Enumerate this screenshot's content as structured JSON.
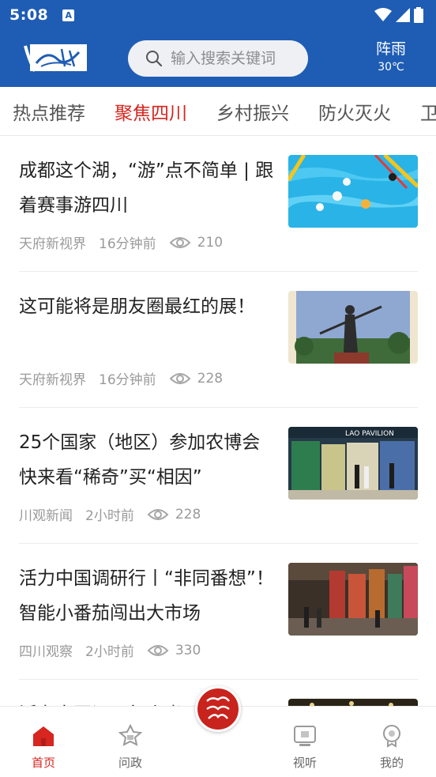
{
  "status_bar": {
    "time": "5:08"
  },
  "header": {
    "search_placeholder": "输入搜索关键词",
    "weather": {
      "condition": "阵雨",
      "temperature": "30℃"
    }
  },
  "tabs": [
    {
      "label": "热点推荐"
    },
    {
      "label": "聚焦四川"
    },
    {
      "label": "乡村振兴"
    },
    {
      "label": "防火灭火"
    },
    {
      "label": "卫"
    }
  ],
  "active_tab": "聚焦四川",
  "articles": [
    {
      "title": "成都这个湖，“游”点不简单 | 跟着赛事游四川",
      "source": "天府新视界",
      "time": "16分钟前",
      "views": "210"
    },
    {
      "title": "这可能将是朋友圈最红的展！",
      "source": "天府新视界",
      "time": "16分钟前",
      "views": "228"
    },
    {
      "title": "25个国家（地区）参加农博会 快来看“稀奇”买“相因”",
      "source": "川观新闻",
      "time": "2小时前",
      "views": "228"
    },
    {
      "title": "活力中国调研行丨“非同番想”！智能小番茄闯出大市场",
      "source": "四川观察",
      "time": "2小时前",
      "views": "330"
    },
    {
      "title": "活力中国调研行丨光",
      "source": "",
      "time": "",
      "views": ""
    }
  ],
  "bottom_nav": [
    {
      "label": "首页",
      "icon": "home-icon"
    },
    {
      "label": "问政",
      "icon": "inquiry-icon"
    },
    {
      "label": "视听",
      "icon": "tv-icon"
    },
    {
      "label": "我的",
      "icon": "profile-icon"
    }
  ],
  "colors": {
    "primary": "#1f5db4",
    "accent": "#d6261f",
    "center_button": "#c9231d"
  }
}
